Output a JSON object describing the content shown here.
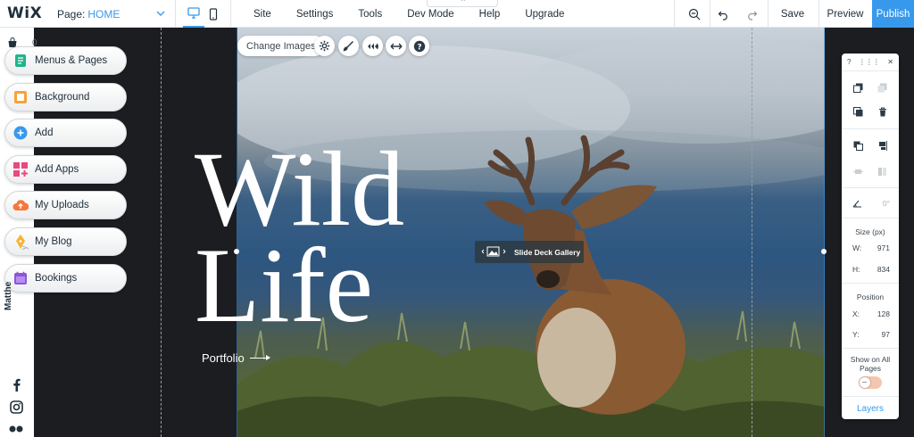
{
  "topbar": {
    "logo": "WiX",
    "page_label": "Page:",
    "page_name": "HOME",
    "menu": [
      {
        "label": "Site"
      },
      {
        "label": "Settings"
      },
      {
        "label": "Tools"
      },
      {
        "label": "Dev Mode"
      },
      {
        "label": "Help"
      },
      {
        "label": "Upgrade"
      }
    ],
    "save": "Save",
    "preview": "Preview",
    "publish": "Publish"
  },
  "left_panel": {
    "cart_count": "0",
    "items": [
      {
        "label": "Menus & Pages",
        "icon": "pages-icon",
        "color": "#1fb58c"
      },
      {
        "label": "Background",
        "icon": "background-icon",
        "color": "#f7a23b"
      },
      {
        "label": "Add",
        "icon": "plus-icon",
        "color": "#3899ec"
      },
      {
        "label": "Add Apps",
        "icon": "apps-icon",
        "color": "#e84a7f"
      },
      {
        "label": "My Uploads",
        "icon": "upload-cloud-icon",
        "color": "#f7763b"
      },
      {
        "label": "My Blog",
        "icon": "pen-icon",
        "color": "#f9b233"
      },
      {
        "label": "Bookings",
        "icon": "calendar-icon",
        "color": "#8e54e0"
      }
    ],
    "vertical_name": "Matthe",
    "vertical_name_faded": "y"
  },
  "canvas": {
    "title_line1": "Wild",
    "title_line2": "Life",
    "portfolio": "Portfolio",
    "gallery_tag": "Slide Deck Gallery",
    "change_images": "Change Images"
  },
  "properties": {
    "help": "?",
    "size_title": "Size (px)",
    "w_label": "W:",
    "w_value": "971",
    "h_label": "H:",
    "h_value": "834",
    "rotation_value": "0°",
    "position_title": "Position",
    "x_label": "X:",
    "x_value": "128",
    "y_label": "Y:",
    "y_value": "97",
    "show_all_pages": "Show on All Pages",
    "layers": "Layers"
  },
  "colors": {
    "accent": "#3899ec",
    "dark_bg": "#1c1d20"
  }
}
